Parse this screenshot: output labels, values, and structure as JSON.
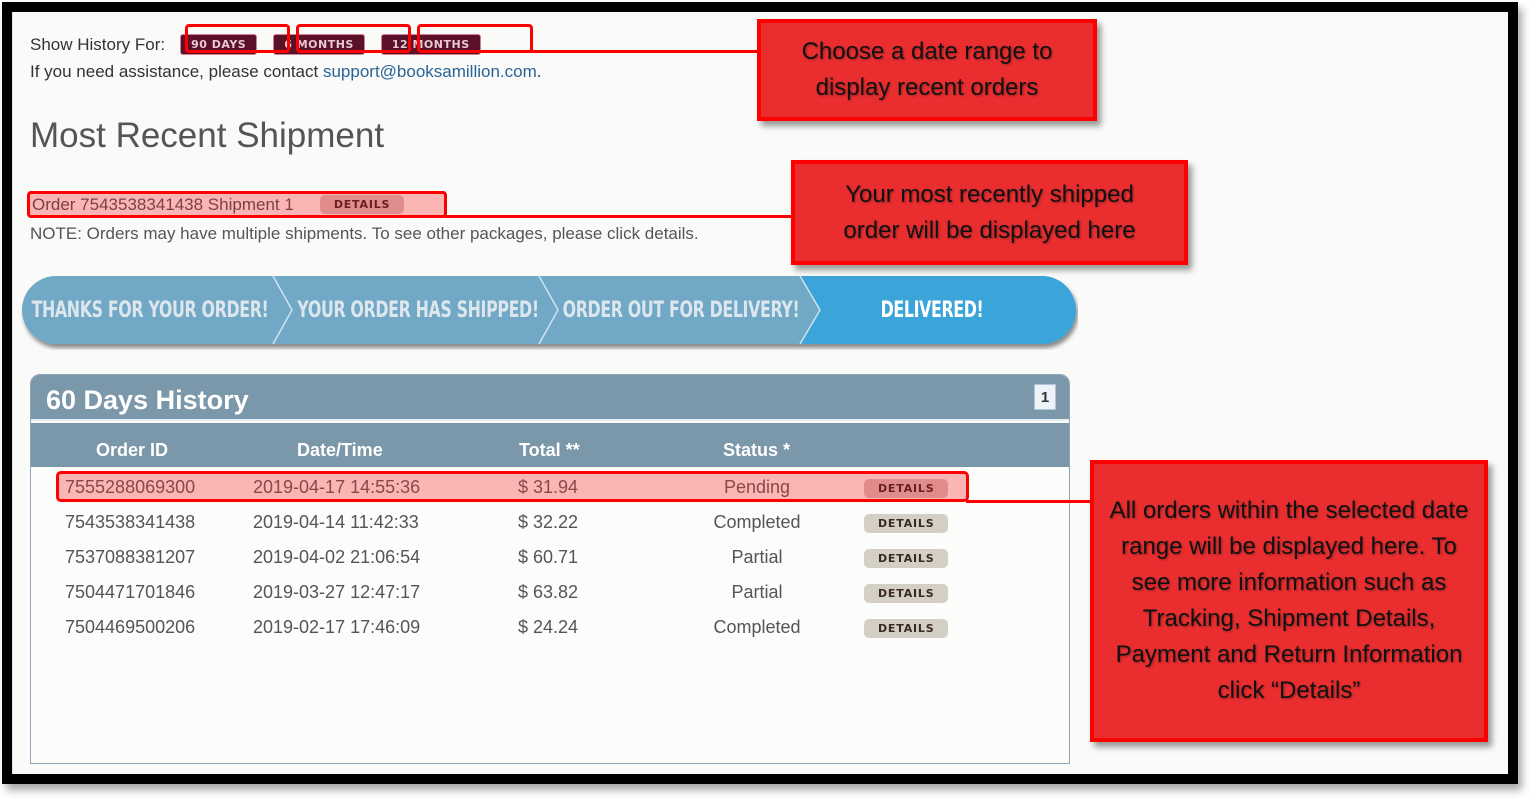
{
  "history_selector": {
    "label": "Show History For:",
    "ranges": [
      "90 DAYS",
      "6 MONTHS",
      "12 MONTHS"
    ]
  },
  "assistance": {
    "text": "If you need assistance, please contact ",
    "email": "support@booksamillion.com",
    "suffix": "."
  },
  "most_recent": {
    "title": "Most Recent Shipment",
    "shipment_text": "Order 7543538341438 Shipment 1",
    "details_label": "DETAILS",
    "note": "NOTE: Orders may have multiple shipments. To see other packages, please click details."
  },
  "tracker": {
    "steps": [
      "THANKS FOR YOUR ORDER!",
      "YOUR ORDER HAS SHIPPED!",
      "ORDER OUT FOR DELIVERY!",
      "DELIVERED!"
    ],
    "active_step": "DELIVERED!",
    "colors": {
      "inactive": "#6fa8c6",
      "active": "#3ba4d9"
    }
  },
  "history": {
    "title": "60 Days History",
    "page": "1",
    "columns": [
      "Order ID",
      "Date/Time",
      "Total **",
      "Status *"
    ],
    "rows": [
      {
        "order_id": "7555288069300",
        "datetime": "2019-04-17 14:55:36",
        "total": "$ 31.94",
        "status": "Pending",
        "action": "DETAILS",
        "highlighted": true
      },
      {
        "order_id": "7543538341438",
        "datetime": "2019-04-14 11:42:33",
        "total": "$ 32.22",
        "status": "Completed",
        "action": "DETAILS"
      },
      {
        "order_id": "7537088381207",
        "datetime": "2019-04-02 21:06:54",
        "total": "$ 60.71",
        "status": "Partial",
        "action": "DETAILS"
      },
      {
        "order_id": "7504471701846",
        "datetime": "2019-03-27 12:47:17",
        "total": "$ 63.82",
        "status": "Partial",
        "action": "DETAILS"
      },
      {
        "order_id": "7504469500206",
        "datetime": "2019-02-17 17:46:09",
        "total": "$ 24.24",
        "status": "Completed",
        "action": "DETAILS"
      }
    ]
  },
  "callouts": {
    "date_range": "Choose a date range to display recent orders",
    "recent_shipment": "Your most recently shipped order will be displayed here",
    "orders": "All orders within the selected date range will be displayed here. To see more information such as Tracking, Shipment Details, Payment and Return Information click “Details”"
  },
  "colors": {
    "annotation_red": "#ff0000",
    "callout_fill": "#ea2e30",
    "range_button": "#5b1129",
    "panel_header": "#7b97aa"
  }
}
